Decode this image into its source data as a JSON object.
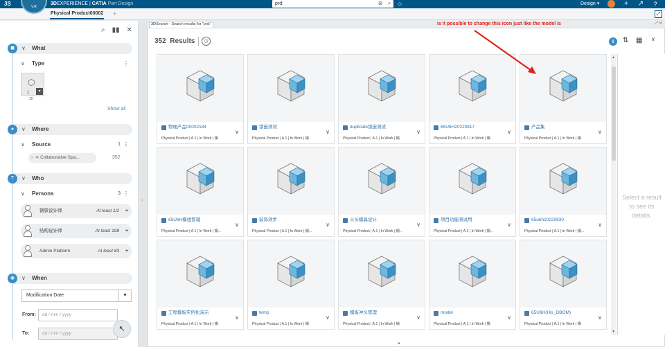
{
  "topbar": {
    "logo": "3S",
    "compass_version": "V.R",
    "brand_main": "3D",
    "brand_rest": "EXPERIENCE",
    "brand_sep": " | ",
    "brand_app": "CATIA",
    "brand_sub": " Part Design",
    "search_value": "prd:",
    "role_label": "Design",
    "icons": [
      "tag-icon",
      "add-icon",
      "share-icon",
      "help-icon"
    ]
  },
  "tabs": {
    "active_label": "Physical Product00002"
  },
  "filters": {
    "what": {
      "label": "What",
      "type_label": "Type",
      "tile_count": "1",
      "tile_caption": "3D",
      "show_all": "Show all"
    },
    "where": {
      "label": "Where",
      "source_label": "Source",
      "source_count": "1",
      "source_item": "Collaborative Spa...",
      "source_item_count": "352"
    },
    "who": {
      "label": "Who",
      "persons_label": "Persons",
      "persons_count": "3",
      "persons": [
        {
          "name": "钢铁设计师",
          "at_least": "At least 1/2"
        },
        {
          "name": "结构设计师",
          "at_least": "At least 108"
        },
        {
          "name": "Admin Platform",
          "at_least": "At least 83"
        }
      ]
    },
    "when": {
      "label": "When",
      "select_value": "Modification Date",
      "from_label": "From:",
      "to_label": "To:",
      "date_placeholder": "dd / mm / yyyy"
    }
  },
  "search_panel": {
    "tab_label": "3DSearch - Search results for \"prd:\"",
    "annotation": "is it possible to  change this icon just like the model is",
    "results_count": "352",
    "results_label": "Results",
    "details_placeholder": "Select a result to see its details."
  },
  "cards": [
    {
      "title": "物理产品00002184",
      "meta": "Physical Product | A.1 | In Work | 锡"
    },
    {
      "title": "锁嵌测试",
      "meta": "Physical Product | A.1 | In Work | 锡"
    },
    {
      "title": "duplicate锁嵌测试",
      "meta": "Physical Product | A.1 | In Work | 锡"
    },
    {
      "title": "65U6H20220817",
      "meta": "Physical Product | A.1 | In Work | 锡"
    },
    {
      "title": "产品集",
      "meta": "Physical Product | A.1 | In Work | 锡"
    },
    {
      "title": "65U6H模组管理",
      "meta": "Physical Product | A.1 | In Work | 钢..."
    },
    {
      "title": "装饰测步",
      "meta": "Physical Product | A.1 | In Work | 钢..."
    },
    {
      "title": "斗头模具设计",
      "meta": "Physical Product | A.1 | In Work | 钢..."
    },
    {
      "title": "项目功能测试用",
      "meta": "Physical Product | A.1 | In Work | 钢..."
    },
    {
      "title": "65u6h20220830",
      "meta": "Physical Product | A.1 | In Work | 钢..."
    },
    {
      "title": "工程模板实例化演示",
      "meta": "Physical Product | A.1 | In Work | 锡"
    },
    {
      "title": "temp",
      "meta": "Physical Product | A.1 | In Work | 锡"
    },
    {
      "title": "模板冲头管理",
      "meta": "Physical Product | A.1 | In Work | 锡"
    },
    {
      "title": "model",
      "meta": "Physical Product | A.1 | In Work | 锡"
    },
    {
      "title": "65U6H(His_DBOM)",
      "meta": "Physical Product | A.1 | In Work | 锡"
    }
  ],
  "colors": {
    "topbar": "#005686",
    "accent": "#3a8dc8",
    "link": "#2f74ad",
    "annotation": "#e0201a"
  }
}
